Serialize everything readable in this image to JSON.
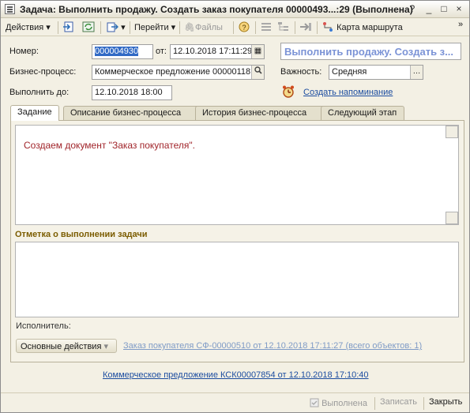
{
  "window": {
    "title": "Задача: Выполнить продажу. Создать заказ покупателя 00000493...:29 (Выполнена)",
    "controls": {
      "help": "?",
      "minimize": "_",
      "maximize": "□",
      "close": "×"
    }
  },
  "toolbar": {
    "actions": "Действия",
    "goto": "Перейти",
    "files": "Файлы",
    "route_map": "Карта маршрута",
    "more": "»"
  },
  "form": {
    "number_label": "Номер:",
    "number_value": "000004930",
    "date_label": "от:",
    "date_value": "12.10.2018 17:11:29",
    "header_caption": "Выполнить продажу. Создать з...",
    "process_label": "Бизнес-процесс:",
    "process_value": "Коммерческое предложение 00000118",
    "importance_label": "Важность:",
    "importance_value": "Средняя",
    "due_label": "Выполнить до:",
    "due_value": "12.10.2018  18:00",
    "reminder_link": "Создать напоминание"
  },
  "tabs": [
    {
      "label": "Задание"
    },
    {
      "label": "Описание бизнес-процесса"
    },
    {
      "label": "История бизнес-процесса"
    },
    {
      "label": "Следующий этап"
    }
  ],
  "task": {
    "description": "Создаем документ \"Заказ покупателя\".",
    "completion_heading": "Отметка о выполнении задачи",
    "completion_text": "",
    "executor_label": "Исполнитель:",
    "main_actions": "Основные действия",
    "related_link": "Заказ покупателя СФ-00000510 от 12.10.2018 17:11:27 (всего объектов: 1)"
  },
  "footer": {
    "basis_link": "Коммерческое предложение КСК00007854 от 12.10.2018 17:10:40",
    "done_button": "Выполнена",
    "save_button": "Записать",
    "close_button": "Закрыть"
  },
  "colors": {
    "window_bg": "#f3f0e4",
    "description_text": "#a1252b",
    "heading_text": "#7b5c00",
    "link": "#1c4da0",
    "selection": "#316ac5"
  }
}
